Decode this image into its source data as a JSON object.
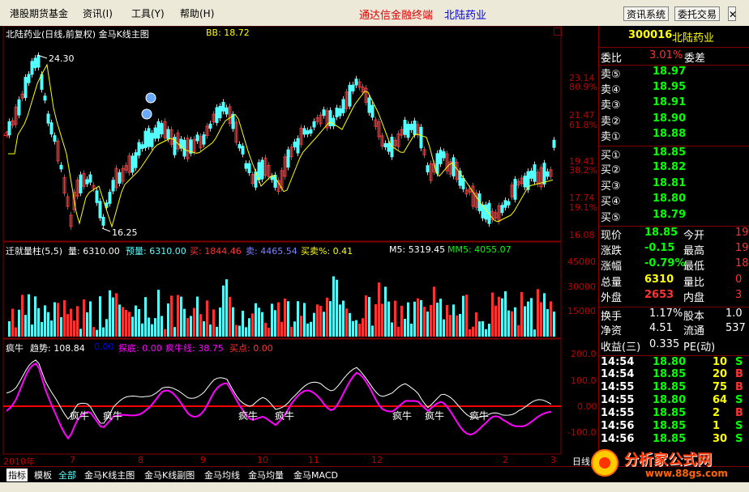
{
  "menu": {
    "items": [
      "港股期货基金",
      "资讯(I)",
      "工具(Y)",
      "帮助(H)"
    ],
    "title_left": "通达信金融终端",
    "title_right": "北陆药业",
    "btn_news": "资讯系统",
    "btn_trade": "委托交易"
  },
  "main_chart": {
    "header_title": "北陆药业(日线,前复权) 金马K线主图",
    "bb": "BB: 18.72",
    "hi_label": "24.30",
    "lo_label": "16.25",
    "left_mark": "4",
    "y_axis": [
      {
        "price": "23.14",
        "pct": "80.9%"
      },
      {
        "price": "21.47",
        "pct": "61.8%"
      },
      {
        "price": "19.41",
        "pct": "38.2%"
      },
      {
        "price": "17.74",
        "pct": "19.1%"
      },
      {
        "price": "16.08",
        "pct": ""
      }
    ]
  },
  "volume_panel": {
    "title": "迁就量柱(5,5)",
    "vol": "量: 6310.00",
    "pre_vol": "预量: 6310.00",
    "buy": "买: 1844.46",
    "sell": "卖: 4465.54",
    "ratio": "买卖%: 0.41",
    "m5": "M5: 5319.45",
    "mm5": "MM5: 4055.07",
    "y_axis": [
      "45000",
      "30000",
      "15000"
    ]
  },
  "indicator_panel": {
    "name": "疯牛",
    "trend": "趋势: 108.84",
    "zero": "0.00",
    "bottom": "探底: 0.00",
    "bull_line": "疯牛线: 38.75",
    "buy_point": "买点: 0.00",
    "y_axis": [
      "200.0",
      "100.0",
      "0.00",
      "-100.0"
    ],
    "bull_tags": [
      "疯牛",
      "疯牛",
      "疯牛",
      "疯牛",
      "疯牛",
      "疯牛",
      "疯牛"
    ]
  },
  "x_axis": {
    "labels": [
      "2010年",
      "7",
      "8",
      "9",
      "10",
      "11",
      "12",
      "2",
      "3"
    ],
    "right_tag": "日线"
  },
  "quote": {
    "code": "300016",
    "name": "北陆药业",
    "wb_label": "委比",
    "wb_value": "3.01%",
    "wc_label": "委差",
    "sells": [
      {
        "label": "卖⑤",
        "price": "18.97"
      },
      {
        "label": "卖④",
        "price": "18.95"
      },
      {
        "label": "卖③",
        "price": "18.91"
      },
      {
        "label": "卖②",
        "price": "18.90"
      },
      {
        "label": "卖①",
        "price": "18.88"
      }
    ],
    "buys": [
      {
        "label": "买①",
        "price": "18.85"
      },
      {
        "label": "买②",
        "price": "18.82"
      },
      {
        "label": "买③",
        "price": "18.81"
      },
      {
        "label": "买④",
        "price": "18.80"
      },
      {
        "label": "买⑤",
        "price": "18.79"
      }
    ],
    "stats": [
      {
        "k1": "现价",
        "v1": "18.85",
        "k2": "今开",
        "v2": "19"
      },
      {
        "k1": "涨跌",
        "v1": "-0.15",
        "k2": "最高",
        "v2": "19"
      },
      {
        "k1": "涨幅",
        "v1": "-0.79%",
        "k2": "最低",
        "v2": "18"
      },
      {
        "k1": "总量",
        "v1": "6310",
        "k2": "量比",
        "v2": "0"
      },
      {
        "k1": "外盘",
        "v1": "2653",
        "k2": "内盘",
        "v2": "3"
      }
    ],
    "stats2": [
      {
        "k1": "换手",
        "v1": "1.17%",
        "k2": "股本",
        "v2": "1.0"
      },
      {
        "k1": "净资",
        "v1": "4.51",
        "k2": "流通",
        "v2": "537"
      },
      {
        "k1": "收益(三)",
        "v1": "0.335",
        "k2": "PE(动)",
        "v2": ""
      }
    ],
    "ticks": [
      {
        "time": "14:54",
        "price": "18.80",
        "vol": "10",
        "side": "S"
      },
      {
        "time": "14:54",
        "price": "18.85",
        "vol": "20",
        "side": "B"
      },
      {
        "time": "14:55",
        "price": "18.85",
        "vol": "75",
        "side": "B"
      },
      {
        "time": "14:55",
        "price": "18.80",
        "vol": "64",
        "side": "S"
      },
      {
        "time": "14:55",
        "price": "18.85",
        "vol": "2",
        "side": "B"
      },
      {
        "time": "14:56",
        "price": "18.85",
        "vol": "1",
        "side": "S"
      },
      {
        "time": "14:56",
        "price": "18.85",
        "vol": "30",
        "side": "S"
      }
    ]
  },
  "tabs": [
    "指标",
    "模板",
    "全部",
    "金马K线主图",
    "金马K线副图",
    "金马均线",
    "金马均量",
    "金马MACD"
  ],
  "logo": {
    "text": "分析家公式网",
    "url": "www.88gs.com"
  },
  "colors": {
    "up": "#ff3232",
    "down": "#54ffff",
    "grid": "#800000",
    "axis_text": "#c00000",
    "yellow": "#ffff00",
    "magenta": "#ff00ff"
  }
}
